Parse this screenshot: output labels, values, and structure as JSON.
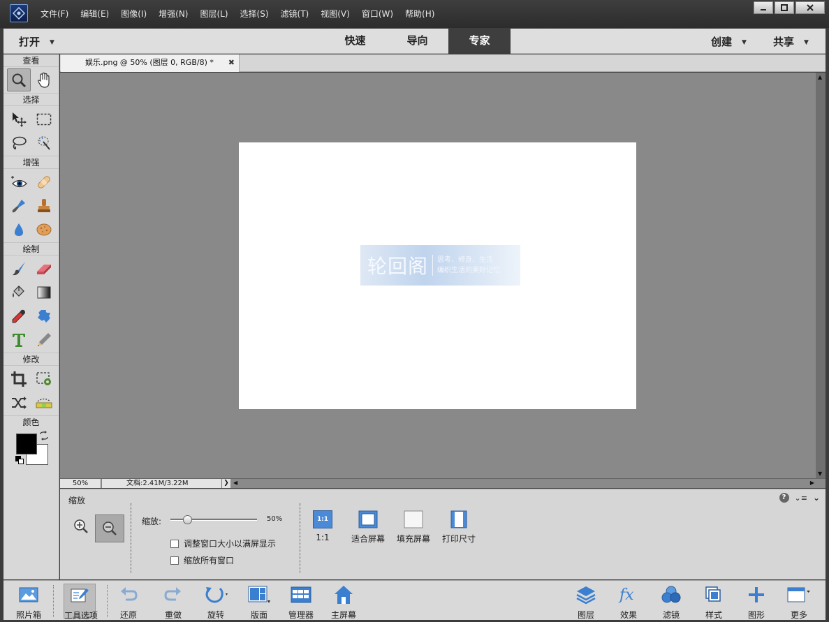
{
  "menu": {
    "items": [
      "文件(F)",
      "编辑(E)",
      "图像(I)",
      "增强(N)",
      "图层(L)",
      "选择(S)",
      "滤镜(T)",
      "视图(V)",
      "窗口(W)",
      "帮助(H)"
    ]
  },
  "window_controls": [
    "minimize",
    "maximize",
    "close"
  ],
  "modebar": {
    "open_label": "打开",
    "tabs": [
      "快速",
      "导向",
      "专家"
    ],
    "active_tab": "专家",
    "create_label": "创建",
    "share_label": "共享"
  },
  "toolbox": {
    "sections": {
      "view": "查看",
      "select": "选择",
      "enhance": "增强",
      "draw": "绘制",
      "modify": "修改",
      "color": "颜色"
    },
    "foreground_color": "#000000",
    "background_color": "#ffffff"
  },
  "document": {
    "tab_title": "娱乐.png @ 50% (图层 0, RGB/8) *",
    "watermark_title": "轮回阁",
    "watermark_line1": "思考、修身、生活",
    "watermark_line2": "编织生活的美好记忆"
  },
  "status": {
    "zoom": "50%",
    "doc_info": "文档:2.41M/3.22M"
  },
  "options": {
    "title": "缩放",
    "zoom_label": "缩放:",
    "zoom_value": "50%",
    "zoom_level": 0.16,
    "check_resize": "调整窗口大小以满屏显示",
    "check_all": "缩放所有窗口",
    "btn_1to1_icon": "1:1",
    "btn_1to1": "1:1",
    "btn_fit": "适合屏幕",
    "btn_fill": "填充屏幕",
    "btn_print": "打印尺寸"
  },
  "taskbar": {
    "photo_bin": "照片箱",
    "tool_options": "工具选项",
    "undo": "还原",
    "redo": "重做",
    "rotate": "旋转",
    "layout": "版面",
    "organizer": "管理器",
    "home": "主屏幕",
    "layers": "图层",
    "effects": "效果",
    "filters": "滤镜",
    "styles": "样式",
    "graphics": "图形",
    "more": "更多"
  },
  "colors": {
    "accent_blue": "#3b7fd0",
    "canvas_gray": "#898989"
  }
}
